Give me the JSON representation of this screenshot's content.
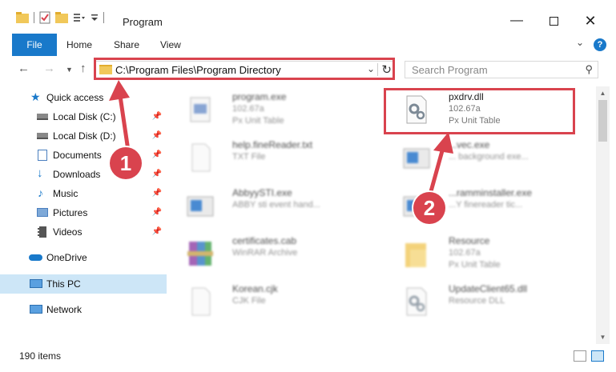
{
  "window": {
    "title": "Program"
  },
  "ribbon": {
    "file": "File",
    "tabs": [
      "Home",
      "Share",
      "View"
    ],
    "help": "?"
  },
  "address": {
    "path": "C:\\Program Files\\Program Directory"
  },
  "search": {
    "placeholder": "Search Program"
  },
  "nav": {
    "quick_access": "Quick access",
    "items": [
      {
        "label": "Local Disk (C:)"
      },
      {
        "label": "Local Disk (D:)"
      },
      {
        "label": "Documents"
      },
      {
        "label": "Downloads"
      },
      {
        "label": "Music"
      },
      {
        "label": "Pictures"
      },
      {
        "label": "Videos"
      }
    ],
    "onedrive": "OneDrive",
    "this_pc": "This PC",
    "network": "Network"
  },
  "files": [
    {
      "name": "program.exe",
      "line1": "102.67a",
      "line2": "Px Unit Table"
    },
    {
      "name": "pxdrv.dll",
      "line1": "102.67a",
      "line2": "Px Unit Table"
    },
    {
      "name": "help.fineReader.txt",
      "line1": "TXT File",
      "line2": ""
    },
    {
      "name": "...vec.exe",
      "line1": "... background exe...",
      "line2": ""
    },
    {
      "name": "AbbyySTI.exe",
      "line1": "ABBY sti event hand...",
      "line2": ""
    },
    {
      "name": "...ramminstaller.exe",
      "line1": "...Y finereader tic...",
      "line2": ""
    },
    {
      "name": "certificates.cab",
      "line1": "WinRAR Archive",
      "line2": ""
    },
    {
      "name": "Resource",
      "line1": "102.67a",
      "line2": "Px Unit Table"
    },
    {
      "name": "Korean.cjk",
      "line1": "CJK File",
      "line2": ""
    },
    {
      "name": "UpdateClient65.dll",
      "line1": "Resource DLL",
      "line2": ""
    }
  ],
  "status": {
    "count": "190 items"
  },
  "callouts": {
    "one": "1",
    "two": "2"
  },
  "colors": {
    "accent": "#1979ca",
    "highlight": "#d9434e",
    "selected": "#cde6f7"
  }
}
